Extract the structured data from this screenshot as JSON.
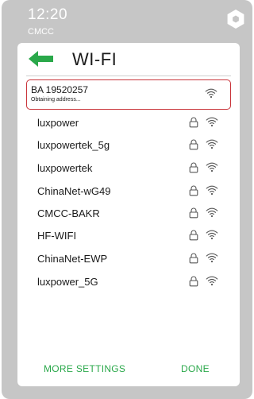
{
  "status_bar": {
    "time": "12:20",
    "carrier": "CMCC"
  },
  "header": {
    "title": "WI-FI",
    "back_icon": "back-arrow-icon"
  },
  "networks": [
    {
      "ssid": "BA 19520257",
      "status": "Obtaining address...",
      "secured": false,
      "selected": true
    },
    {
      "ssid": "luxpower",
      "secured": true
    },
    {
      "ssid": "luxpowertek_5g",
      "secured": true
    },
    {
      "ssid": "luxpowertek",
      "secured": true
    },
    {
      "ssid": "ChinaNet-wG49",
      "secured": true
    },
    {
      "ssid": "CMCC-BAKR",
      "secured": true
    },
    {
      "ssid": "HF-WIFI",
      "secured": true
    },
    {
      "ssid": "ChinaNet-EWP",
      "secured": true
    },
    {
      "ssid": "luxpower_5G",
      "secured": true
    }
  ],
  "footer": {
    "more_label": "MORE SETTINGS",
    "done_label": "DONE"
  },
  "colors": {
    "accent_green": "#2aa84a",
    "selection_red": "#c9343a",
    "frame_gray": "#c6c6c6"
  }
}
